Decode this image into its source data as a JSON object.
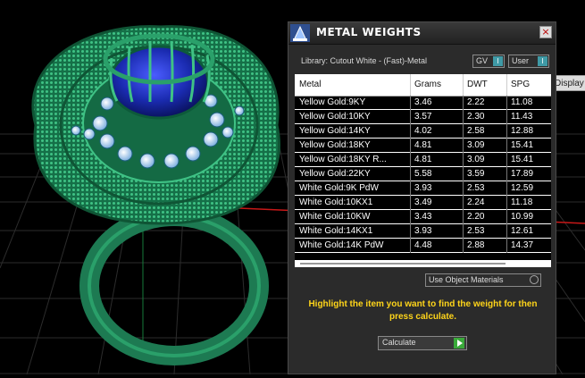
{
  "dialog": {
    "title": "METAL WEIGHTS",
    "close_glyph": "×",
    "library": "Library: Cutout White - (Fast)-Metal",
    "gv_label": "GV",
    "user_label": "User",
    "toggle_glyph": "I",
    "tooltip": "Display",
    "columns": [
      "Metal",
      "Grams",
      "DWT",
      "SPG"
    ],
    "rows": [
      [
        "Yellow Gold:9KY",
        "3.46",
        "2.22",
        "11.08"
      ],
      [
        "Yellow Gold:10KY",
        "3.57",
        "2.30",
        "11.43"
      ],
      [
        "Yellow Gold:14KY",
        "4.02",
        "2.58",
        "12.88"
      ],
      [
        "Yellow Gold:18KY",
        "4.81",
        "3.09",
        "15.41"
      ],
      [
        "Yellow Gold:18KY R...",
        "4.81",
        "3.09",
        "15.41"
      ],
      [
        "Yellow Gold:22KY",
        "5.58",
        "3.59",
        "17.89"
      ],
      [
        "White Gold:9K PdW",
        "3.93",
        "2.53",
        "12.59"
      ],
      [
        "White Gold:10KX1",
        "3.49",
        "2.24",
        "11.18"
      ],
      [
        "White Gold:10KW",
        "3.43",
        "2.20",
        "10.99"
      ],
      [
        "White Gold:14KX1",
        "3.93",
        "2.53",
        "12.61"
      ],
      [
        "White Gold:14K PdW",
        "4.48",
        "2.88",
        "14.37"
      ]
    ],
    "use_object_materials": "Use Object Materials",
    "instruction": "Highlight the item you want to find the weight for then press calculate.",
    "calculate": "Calculate"
  },
  "colors": {
    "instruction": "#ffd51a",
    "ring": "#1f8a5a",
    "gem": "#1a2bb0",
    "accent": "#3f9aa6"
  },
  "icons": [
    "metal-weights-app-icon",
    "close-icon",
    "toggle-icon",
    "radio-icon",
    "play-icon"
  ]
}
